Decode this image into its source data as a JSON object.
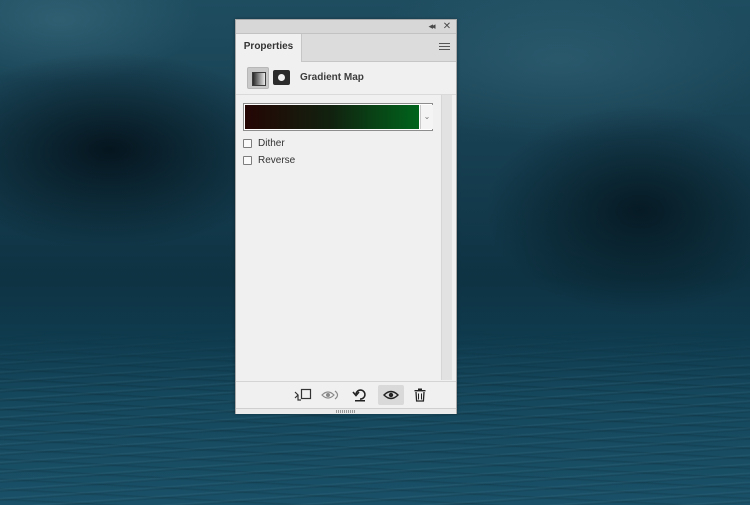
{
  "panel": {
    "tab_label": "Properties",
    "collapse_glyph": "◂◂",
    "close_glyph": "✕",
    "menu_icon": "hamburger-menu-icon"
  },
  "adjustment": {
    "title": "Gradient Map",
    "adjustment_icon": "gradient-map-icon",
    "mask_icon": "layer-mask-icon",
    "gradient": {
      "colors": [
        "#240605",
        "#11220f",
        "#00641c"
      ],
      "dropdown_glyph": "⌄"
    },
    "options": [
      {
        "label": "Dither",
        "checked": false
      },
      {
        "label": "Reverse",
        "checked": false
      }
    ]
  },
  "footer": {
    "buttons": [
      {
        "name": "clip-to-layer",
        "icon": "clip-to-layer-icon"
      },
      {
        "name": "view-previous-state",
        "icon": "view-previous-state-icon"
      },
      {
        "name": "reset-to-defaults",
        "icon": "reset-icon"
      },
      {
        "name": "toggle-visibility",
        "icon": "eye-icon",
        "active": true
      },
      {
        "name": "delete-adjustment",
        "icon": "trash-icon"
      }
    ]
  }
}
